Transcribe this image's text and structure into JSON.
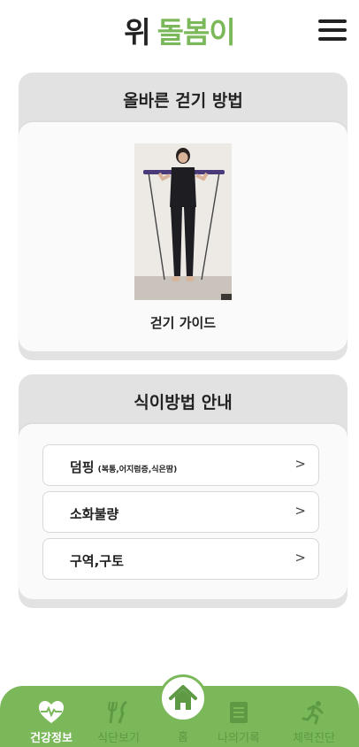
{
  "header": {
    "logo_part1": "위",
    "logo_part2": "돌봄이",
    "menu_icon": "hamburger-icon"
  },
  "walk_card": {
    "title": "올바른 걷기 방법",
    "caption": "걷기 가이드"
  },
  "diet_card": {
    "title": "식이방법 안내",
    "items": [
      {
        "label": "덤핑",
        "sub": "(복통,어지럼증,식은땀)"
      },
      {
        "label": "소화불량",
        "sub": ""
      },
      {
        "label": "구역,구토",
        "sub": ""
      }
    ],
    "chevron": ">"
  },
  "nav": {
    "items": [
      {
        "label": "건강정보",
        "icon": "heart-pulse-icon",
        "active": true
      },
      {
        "label": "식단보기",
        "icon": "utensils-icon",
        "active": false
      },
      {
        "label": "홈",
        "icon": "home-icon",
        "active": false
      },
      {
        "label": "나의기록",
        "icon": "notebook-icon",
        "active": false
      },
      {
        "label": "체력진단",
        "icon": "running-icon",
        "active": false
      }
    ]
  },
  "colors": {
    "brand_green": "#7ab85a",
    "card_bg": "#e2e2e2",
    "text_dark": "#222222"
  }
}
